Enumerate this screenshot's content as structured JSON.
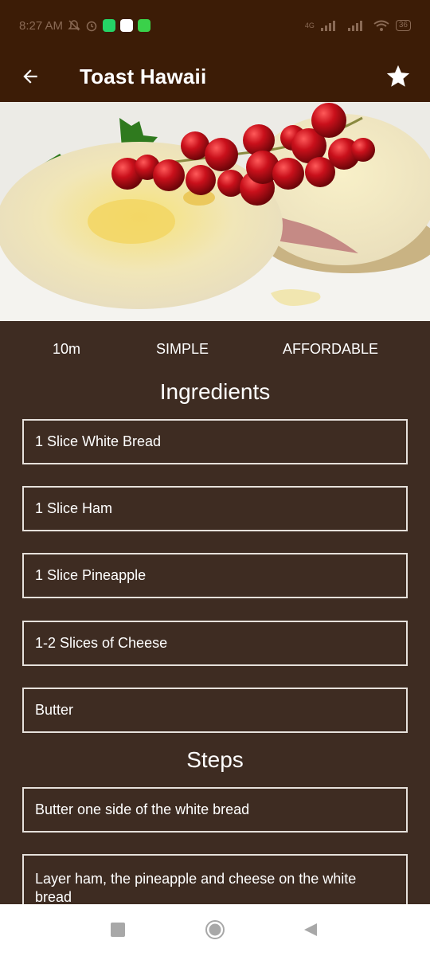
{
  "status_bar": {
    "time": "8:27 AM",
    "network": "4G",
    "battery": "36"
  },
  "app_bar": {
    "title": "Toast Hawaii",
    "back_icon": "arrow-left-icon",
    "favorite_icon": "star-icon"
  },
  "meta": {
    "duration": "10m",
    "complexity": "SIMPLE",
    "affordability": "AFFORDABLE"
  },
  "ingredients_title": "Ingredients",
  "ingredients": [
    "1 Slice White Bread",
    "1 Slice Ham",
    "1 Slice Pineapple",
    "1-2 Slices of Cheese",
    "Butter"
  ],
  "steps_title": "Steps",
  "steps": [
    "Butter one side of the white bread",
    "Layer ham, the pineapple and cheese on the white bread"
  ],
  "colors": {
    "app_bar": "#3c1c06",
    "background": "#3e2c22",
    "card_border": "#e6e1dc"
  }
}
